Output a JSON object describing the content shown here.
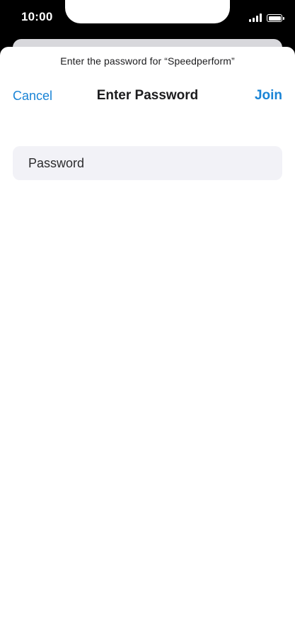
{
  "status_bar": {
    "time": "10:00",
    "signal_icon": "cellular-signal-icon",
    "battery_icon": "battery-icon"
  },
  "sheet": {
    "prompt": "Enter the password for “Speedperform”",
    "title": "Enter Password",
    "cancel_label": "Cancel",
    "join_label": "Join"
  },
  "password_input": {
    "value": "",
    "placeholder": "Password"
  },
  "colors": {
    "accent": "#1a84d6",
    "field_background": "#f2f2f7",
    "status_bar_background": "#000000"
  }
}
